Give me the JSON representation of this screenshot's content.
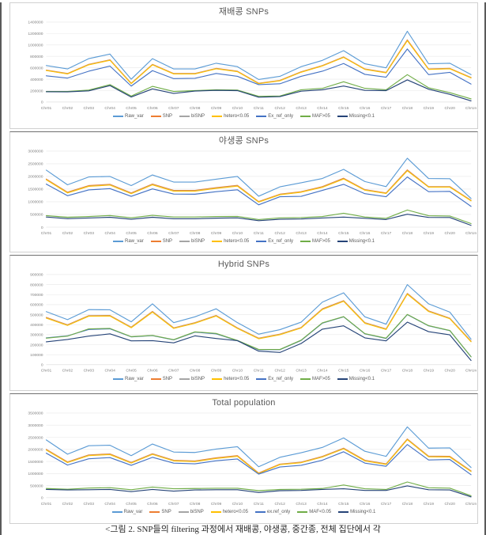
{
  "document": {
    "caption": "<그림 2. SNP들의 filtering 과정에서 재배콩, 야생콩, 중간종, 전체 집단에서 각"
  },
  "palette": {
    "Raw_var": "#5B9BD5",
    "SNP": "#ED7D31",
    "biSNP": "#A5A5A5",
    "hetero": "#FFC000",
    "Ex_ref_only": "#4472C4",
    "MAF": "#70AD47",
    "Missing": "#264478"
  },
  "categories": [
    "Chr01",
    "Chr02",
    "Chr03",
    "Chr04",
    "Chr05",
    "Chr06",
    "Chr07",
    "Chr08",
    "Chr09",
    "Chr10",
    "Chr11",
    "Chr12",
    "Chr13",
    "Chr14",
    "Chr15",
    "Chr16",
    "Chr17",
    "Chr18",
    "Chr19",
    "Chr20",
    "ChrUn"
  ],
  "chart_data": [
    {
      "id": "cultivated",
      "type": "line",
      "title": "재배콩 SNPs",
      "xlabel": "",
      "ylabel": "",
      "ylim": [
        0,
        1400000
      ],
      "ytick_step": 200000,
      "yticks": [
        0,
        200000,
        400000,
        600000,
        800000,
        1000000,
        1200000,
        1400000
      ],
      "grid": true,
      "legend_position": "bottom",
      "categories": [
        "Chr01",
        "Chr02",
        "Chr03",
        "Chr04",
        "Chr05",
        "Chr06",
        "Chr07",
        "Chr08",
        "Chr09",
        "Chr10",
        "Chr11",
        "Chr12",
        "Chr13",
        "Chr14",
        "Chr15",
        "Chr16",
        "Chr17",
        "Chr18",
        "Chr19",
        "Chr20",
        "ChrUn"
      ],
      "series": [
        {
          "name": "Raw_var",
          "color": "#5B9BD5",
          "values": [
            640000,
            580000,
            760000,
            840000,
            400000,
            760000,
            580000,
            580000,
            680000,
            620000,
            395000,
            450000,
            620000,
            730000,
            900000,
            670000,
            600000,
            1240000,
            670000,
            680000,
            480000
          ]
        },
        {
          "name": "SNP",
          "color": "#ED7D31",
          "values": [
            560000,
            500000,
            660000,
            740000,
            330000,
            660000,
            500000,
            500000,
            590000,
            540000,
            330000,
            380000,
            530000,
            640000,
            790000,
            580000,
            520000,
            1090000,
            580000,
            590000,
            430000
          ]
        },
        {
          "name": "biSNP",
          "color": "#A5A5A5",
          "values": [
            555000,
            495000,
            655000,
            735000,
            325000,
            655000,
            495000,
            495000,
            585000,
            535000,
            325000,
            375000,
            525000,
            635000,
            785000,
            575000,
            515000,
            1080000,
            575000,
            585000,
            425000
          ]
        },
        {
          "name": "hetero<0.05",
          "color": "#FFC000",
          "values": [
            552000,
            492000,
            652000,
            732000,
            322000,
            652000,
            492000,
            492000,
            582000,
            532000,
            322000,
            372000,
            522000,
            632000,
            782000,
            572000,
            512000,
            1075000,
            572000,
            582000,
            422000
          ]
        },
        {
          "name": "Ex_ref_only",
          "color": "#4472C4",
          "values": [
            460000,
            420000,
            540000,
            630000,
            280000,
            550000,
            410000,
            415000,
            500000,
            450000,
            305000,
            320000,
            450000,
            540000,
            675000,
            485000,
            435000,
            930000,
            480000,
            520000,
            315000
          ]
        },
        {
          "name": "MAF>05",
          "color": "#70AD47",
          "values": [
            185000,
            185000,
            210000,
            305000,
            105000,
            275000,
            185000,
            200000,
            215000,
            210000,
            100000,
            105000,
            215000,
            240000,
            355000,
            240000,
            215000,
            480000,
            250000,
            165000,
            55000
          ]
        },
        {
          "name": "Missing<0.1",
          "color": "#264478",
          "values": [
            180000,
            178000,
            195000,
            288000,
            88000,
            230000,
            150000,
            192000,
            205000,
            200000,
            85000,
            95000,
            190000,
            215000,
            280000,
            205000,
            200000,
            388000,
            225000,
            135000,
            20000
          ]
        }
      ]
    },
    {
      "id": "wild",
      "type": "line",
      "title": "야생콩 SNPs",
      "xlabel": "",
      "ylabel": "",
      "ylim": [
        0,
        3000000
      ],
      "ytick_step": 500000,
      "yticks": [
        0,
        500000,
        1000000,
        1500000,
        2000000,
        2500000,
        3000000
      ],
      "grid": true,
      "legend_position": "bottom",
      "categories": [
        "Chr01",
        "Chr02",
        "Chr03",
        "Chr04",
        "Chr05",
        "Chr06",
        "Chr07",
        "Chr08",
        "Chr09",
        "Chr10",
        "Chr11",
        "Chr12",
        "Chr13",
        "Chr14",
        "Chr15",
        "Chr16",
        "Chr17",
        "Chr18",
        "Chr19",
        "Chr20",
        "ChrUn"
      ],
      "series": [
        {
          "name": "Raw_var",
          "color": "#5B9BD5",
          "values": [
            2250000,
            1670000,
            1980000,
            2000000,
            1640000,
            2060000,
            1780000,
            1780000,
            1890000,
            2000000,
            1220000,
            1590000,
            1750000,
            1920000,
            2280000,
            1800000,
            1600000,
            2720000,
            1920000,
            1910000,
            1130000
          ]
        },
        {
          "name": "SNP",
          "color": "#ED7D31",
          "values": [
            1900000,
            1380000,
            1640000,
            1690000,
            1350000,
            1700000,
            1450000,
            1450000,
            1560000,
            1650000,
            1010000,
            1300000,
            1400000,
            1600000,
            1930000,
            1480000,
            1350000,
            2260000,
            1600000,
            1600000,
            1060000
          ]
        },
        {
          "name": "biSNP",
          "color": "#A5A5A5",
          "values": [
            1880000,
            1360000,
            1620000,
            1670000,
            1330000,
            1680000,
            1430000,
            1430000,
            1540000,
            1630000,
            995000,
            1285000,
            1385000,
            1580000,
            1910000,
            1465000,
            1335000,
            2235000,
            1585000,
            1585000,
            1045000
          ]
        },
        {
          "name": "hetero<0.05",
          "color": "#FFC000",
          "values": [
            1870000,
            1350000,
            1610000,
            1660000,
            1320000,
            1670000,
            1420000,
            1420000,
            1530000,
            1620000,
            988000,
            1278000,
            1378000,
            1570000,
            1900000,
            1458000,
            1328000,
            2225000,
            1578000,
            1578000,
            1038000
          ]
        },
        {
          "name": "Ex_ref_only",
          "color": "#4472C4",
          "values": [
            1700000,
            1240000,
            1470000,
            1520000,
            1215000,
            1510000,
            1305000,
            1300000,
            1400000,
            1475000,
            880000,
            1200000,
            1215000,
            1450000,
            1690000,
            1320000,
            1200000,
            1980000,
            1400000,
            1410000,
            820000
          ]
        },
        {
          "name": "MAF>05",
          "color": "#70AD47",
          "values": [
            455000,
            390000,
            420000,
            460000,
            370000,
            465000,
            400000,
            400000,
            420000,
            425000,
            300000,
            365000,
            375000,
            420000,
            550000,
            400000,
            345000,
            675000,
            450000,
            440000,
            140000
          ]
        },
        {
          "name": "Missing<0.1",
          "color": "#264478",
          "values": [
            400000,
            335000,
            360000,
            390000,
            310000,
            390000,
            330000,
            330000,
            355000,
            365000,
            255000,
            310000,
            320000,
            360000,
            395000,
            350000,
            300000,
            510000,
            385000,
            380000,
            70000
          ]
        }
      ]
    },
    {
      "id": "hybrid",
      "type": "line",
      "title": "Hybrid SNPs",
      "xlabel": "",
      "ylabel": "",
      "ylim": [
        0,
        900000
      ],
      "ytick_step": 100000,
      "yticks": [
        0,
        100000,
        200000,
        300000,
        400000,
        500000,
        600000,
        700000,
        800000,
        900000
      ],
      "grid": true,
      "legend_position": "bottom",
      "categories": [
        "Chr01",
        "Chr02",
        "Chr03",
        "Chr04",
        "Chr05",
        "Chr06",
        "Chr07",
        "Chr08",
        "Chr09",
        "Chr10",
        "Chr11",
        "Chr12",
        "Chr13",
        "Chr14",
        "Chr15",
        "Chr16",
        "Chr17",
        "Chr18",
        "Chr19",
        "Chr20",
        "ChrUn"
      ],
      "series": [
        {
          "name": "Raw_var",
          "color": "#5B9BD5",
          "values": [
            530000,
            450000,
            550000,
            548000,
            428000,
            608000,
            420000,
            478000,
            558000,
            420000,
            305000,
            350000,
            425000,
            625000,
            718000,
            478000,
            405000,
            800000,
            608000,
            525000,
            255000
          ]
        },
        {
          "name": "SNP",
          "color": "#ED7D31",
          "values": [
            472000,
            398000,
            490000,
            492000,
            375000,
            532000,
            368000,
            420000,
            492000,
            368000,
            265000,
            305000,
            372000,
            558000,
            640000,
            420000,
            358000,
            712000,
            538000,
            465000,
            235000
          ]
        },
        {
          "name": "biSNP",
          "color": "#A5A5A5",
          "values": [
            468000,
            395000,
            487000,
            489000,
            372000,
            528000,
            365000,
            417000,
            489000,
            365000,
            262000,
            302000,
            369000,
            554000,
            636000,
            417000,
            355000,
            708000,
            534000,
            462000,
            232000
          ]
        },
        {
          "name": "hetero<0.05",
          "color": "#FFC000",
          "values": [
            465000,
            392000,
            484000,
            486000,
            369000,
            525000,
            362000,
            414000,
            486000,
            362000,
            259000,
            299000,
            366000,
            551000,
            633000,
            414000,
            352000,
            705000,
            531000,
            459000,
            229000
          ]
        },
        {
          "name": "Ex_ref_only",
          "color": "#4472C4",
          "values": [
            268000,
            288000,
            352000,
            358000,
            278000,
            290000,
            248000,
            325000,
            308000,
            240000,
            150000,
            150000,
            242000,
            415000,
            478000,
            308000,
            262000,
            500000,
            388000,
            340000,
            80000
          ]
        },
        {
          "name": "MAF>05",
          "color": "#70AD47",
          "values": [
            265000,
            285000,
            358000,
            362000,
            280000,
            292000,
            250000,
            328000,
            312000,
            242000,
            152000,
            152000,
            245000,
            418000,
            480000,
            310000,
            265000,
            502000,
            390000,
            342000,
            78000
          ]
        },
        {
          "name": "Missing<0.1",
          "color": "#264478",
          "values": [
            228000,
            252000,
            285000,
            308000,
            238000,
            240000,
            218000,
            288000,
            262000,
            240000,
            135000,
            122000,
            212000,
            355000,
            388000,
            268000,
            238000,
            425000,
            330000,
            298000,
            42000
          ]
        }
      ]
    },
    {
      "id": "total",
      "type": "line",
      "title": "Total population",
      "xlabel": "",
      "ylabel": "",
      "ylim": [
        0,
        3500000
      ],
      "ytick_step": 500000,
      "yticks": [
        0,
        500000,
        1000000,
        1500000,
        2000000,
        2500000,
        3000000,
        3500000
      ],
      "grid": true,
      "legend_position": "bottom",
      "categories": [
        "Chr01",
        "Chr02",
        "Chr03",
        "Chr04",
        "Chr05",
        "Chr06",
        "Chr07",
        "Chr08",
        "Chr09",
        "Chr10",
        "Chr11",
        "Chr12",
        "Chr13",
        "Chr14",
        "Chr15",
        "Chr16",
        "Chr17",
        "Chr18",
        "Chr19",
        "Chr20",
        "ChrUn"
      ],
      "series": [
        {
          "name": "Raw_var",
          "color": "#5B9BD5",
          "values": [
            2390000,
            1800000,
            2150000,
            2170000,
            1740000,
            2220000,
            1890000,
            1870000,
            2010000,
            2110000,
            1280000,
            1670000,
            1860000,
            2080000,
            2470000,
            1920000,
            1710000,
            2930000,
            2050000,
            2060000,
            1250000
          ]
        },
        {
          "name": "SNP",
          "color": "#ED7D31",
          "values": [
            2000000,
            1480000,
            1770000,
            1810000,
            1460000,
            1820000,
            1550000,
            1520000,
            1650000,
            1740000,
            1020000,
            1390000,
            1470000,
            1710000,
            2050000,
            1550000,
            1400000,
            2430000,
            1720000,
            1710000,
            1110000
          ]
        },
        {
          "name": "biSNP",
          "color": "#A5A5A5",
          "values": [
            1980000,
            1462000,
            1752000,
            1792000,
            1442000,
            1802000,
            1532000,
            1502000,
            1632000,
            1722000,
            1005000,
            1375000,
            1455000,
            1692000,
            2032000,
            1532000,
            1385000,
            2410000,
            1702000,
            1692000,
            1092000
          ]
        },
        {
          "name": "hetero<0.05",
          "color": "#FFC000",
          "values": [
            1970000,
            1452000,
            1742000,
            1782000,
            1432000,
            1792000,
            1522000,
            1492000,
            1622000,
            1712000,
            998000,
            1368000,
            1448000,
            1682000,
            2022000,
            1522000,
            1375000,
            2400000,
            1692000,
            1682000,
            1082000
          ]
        },
        {
          "name": "ex.ref_only",
          "color": "#4472C4",
          "values": [
            1840000,
            1350000,
            1610000,
            1660000,
            1340000,
            1670000,
            1430000,
            1400000,
            1530000,
            1600000,
            975000,
            1270000,
            1340000,
            1550000,
            1900000,
            1430000,
            1300000,
            2200000,
            1560000,
            1580000,
            950000
          ]
        },
        {
          "name": "MAF<0.05",
          "color": "#70AD47",
          "values": [
            380000,
            350000,
            400000,
            415000,
            330000,
            440000,
            370000,
            380000,
            390000,
            390000,
            290000,
            340000,
            350000,
            380000,
            525000,
            370000,
            340000,
            650000,
            410000,
            395000,
            80000
          ]
        },
        {
          "name": "Missing<0.1",
          "color": "#264478",
          "values": [
            340000,
            320000,
            330000,
            340000,
            250000,
            340000,
            270000,
            320000,
            330000,
            330000,
            215000,
            290000,
            300000,
            340000,
            370000,
            300000,
            300000,
            490000,
            330000,
            320000,
            35000
          ]
        }
      ]
    }
  ]
}
